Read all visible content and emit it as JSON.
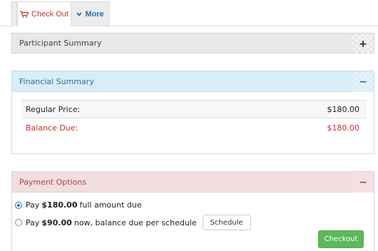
{
  "tabs": {
    "checkout_label": "Check Out",
    "checkout_icon": "cart-icon",
    "more_label": "More",
    "more_icon": "chevron-down-icon"
  },
  "participant_summary": {
    "title": "Participant Summary",
    "toggle": "+"
  },
  "financial_summary": {
    "title": "Financial Summary",
    "toggle": "−",
    "rows": [
      {
        "label": "Regular Price:",
        "value": "$180.00"
      },
      {
        "label": "Balance Due:",
        "value": "$180.00"
      }
    ]
  },
  "payment_options": {
    "title": "Payment Options",
    "toggle": "−",
    "option_full": {
      "prefix": "Pay",
      "amount": "$180.00",
      "suffix": "full amount due",
      "selected": true
    },
    "option_partial": {
      "prefix": "Pay",
      "amount": "$90.00",
      "suffix": "now, balance due per schedule",
      "selected": false
    },
    "schedule_label": "Schedule",
    "checkout_label": "Checkout"
  },
  "colors": {
    "info_header": "#d9edf7",
    "danger_header": "#f2dede",
    "checkout_button": "#5cb85c",
    "balance_text": "#c9302c"
  }
}
